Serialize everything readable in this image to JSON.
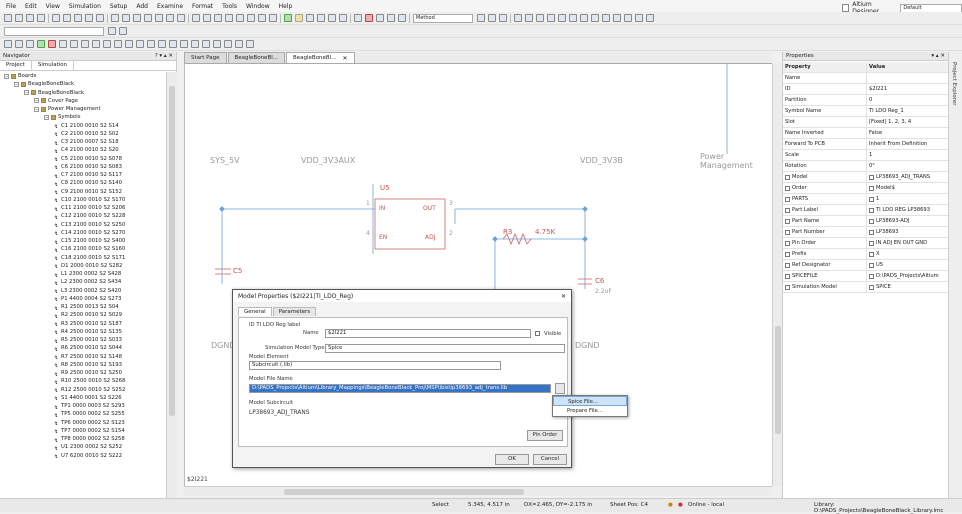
{
  "menu": {
    "items": [
      "File",
      "Edit",
      "View",
      "Simulation",
      "Setup",
      "Add",
      "Examine",
      "Format",
      "Tools",
      "Window",
      "Help"
    ],
    "license_label": "Altium Designer",
    "license_value": "Default"
  },
  "toolbar": {
    "method_value": "Method",
    "search_value": ""
  },
  "navigator": {
    "title": "Navigator",
    "controls": "? ▾ ▴ ✕",
    "tabs": [
      "Project",
      "Simulation"
    ],
    "tree": [
      {
        "label": "Boards",
        "level": 0
      },
      {
        "label": "BeagleBoneBlack",
        "level": 1
      },
      {
        "label": "BeagleBoneBlack",
        "level": 2
      },
      {
        "label": "Cover Page",
        "level": 3
      },
      {
        "label": "Power Management",
        "level": 3
      },
      {
        "label": "Symbols",
        "level": 4
      },
      {
        "label": "C1 2100 0010 S2 S14",
        "level": 5
      },
      {
        "label": "C2 2100 0010 S2 S02",
        "level": 5
      },
      {
        "label": "C3 2100 0007 S2 S18",
        "level": 5
      },
      {
        "label": "C4 2100 0010 S2 S20",
        "level": 5
      },
      {
        "label": "C5 2100 0010 S2 S078",
        "level": 5
      },
      {
        "label": "C6 2100 0010 S2 S083",
        "level": 5
      },
      {
        "label": "C7 2100 0010 S2 S117",
        "level": 5
      },
      {
        "label": "C8 2100 0010 S2 S140",
        "level": 5
      },
      {
        "label": "C9 2100 0010 S2 S152",
        "level": 5
      },
      {
        "label": "C10 2100 0010 S2 S170",
        "level": 5
      },
      {
        "label": "C11 2100 0010 S2 S206",
        "level": 5
      },
      {
        "label": "C12 2100 0010 S2 S228",
        "level": 5
      },
      {
        "label": "C13 2100 0010 S2 S250",
        "level": 5
      },
      {
        "label": "C14 2100 0010 S2 S270",
        "level": 5
      },
      {
        "label": "C15 2100 0010 S2 S400",
        "level": 5
      },
      {
        "label": "C16 2100 0010 S2 S160",
        "level": 5
      },
      {
        "label": "C18 2100 0010 S2 S171",
        "level": 5
      },
      {
        "label": "D1 2000 0010 S2 S282",
        "level": 5
      },
      {
        "label": "L1 2300 0002 S2 S428",
        "level": 5
      },
      {
        "label": "L2 2300 0002 S2 S434",
        "level": 5
      },
      {
        "label": "L3 2300 0002 S2 S420",
        "level": 5
      },
      {
        "label": "P1 4400 0004 S2 S273",
        "level": 5
      },
      {
        "label": "R1 2500 0013 S2 S04",
        "level": 5
      },
      {
        "label": "R2 2500 0010 S2 S029",
        "level": 5
      },
      {
        "label": "R3 2500 0010 S2 S187",
        "level": 5
      },
      {
        "label": "R4 2500 0010 S2 S135",
        "level": 5
      },
      {
        "label": "R5 2500 0010 S2 S033",
        "level": 5
      },
      {
        "label": "R6 2500 0010 S2 S044",
        "level": 5
      },
      {
        "label": "R7 2500 0010 S2 S148",
        "level": 5
      },
      {
        "label": "R8 2500 0010 S2 S193",
        "level": 5
      },
      {
        "label": "R9 2500 0010 S2 S250",
        "level": 5
      },
      {
        "label": "R10 2500 0010 S2 S268",
        "level": 5
      },
      {
        "label": "R12 2500 0010 S2 S252",
        "level": 5
      },
      {
        "label": "S1 4400 0001 S2 S226",
        "level": 5
      },
      {
        "label": "TP1 0000 0003 S2 S293",
        "level": 5
      },
      {
        "label": "TP5 0000 0002 S2 S255",
        "level": 5
      },
      {
        "label": "TP6 0000 0002 S2 S123",
        "level": 5
      },
      {
        "label": "TP7 0000 0002 S2 S154",
        "level": 5
      },
      {
        "label": "TP8 0000 0002 S2 S258",
        "level": 5
      },
      {
        "label": "U1 2300 0002 S2 S252",
        "level": 5
      },
      {
        "label": "U7 6200 0010 S2 S222",
        "level": 5
      }
    ]
  },
  "doc_tabs": [
    "Start Page",
    "BeagleBoneBl...",
    "BeagleBoneBl..."
  ],
  "schematic": {
    "net_sys": "SYS_5V",
    "net_vdd_in": "VDD_3V3AUX",
    "net_vdd_out": "VDD_3V3B",
    "sheet_title": "Power Management",
    "u_ref": "U5",
    "pin_in": "IN",
    "pin_out": "OUT",
    "pin_en": "EN",
    "pin_adj": "ADJ",
    "pin_num_in": "1",
    "pin_num_out": "3",
    "pin_num_en": "4",
    "pin_num_adj": "2",
    "c_left": "C5",
    "c_right": "C6",
    "c_right_val": "2.2uF",
    "r_ref": "R3",
    "r_val": "4.75K",
    "dgnd_left": "DGND",
    "dgnd_right": "DGND",
    "footer_id": "$2I221"
  },
  "dialog": {
    "title": "Model Properties ($2I221|TI_LDO_Reg)",
    "tabs": [
      "General",
      "Parameters"
    ],
    "ld_label": "ID TI LDO Reg label",
    "name_label": "Name",
    "name_value": "$2I221",
    "visible_label": "Visible",
    "sim_type_label": "Simulation Model Type",
    "sim_type_value": "Spice",
    "model_element_label": "Model Element",
    "model_element_value": "Subcircuit (.lib)",
    "model_file_label": "Model File Name",
    "model_file_value": "D:\\PADS_Projects\\Altium\\Library_Mappings\\BeagleBoneBlack_Proj\\MSP\\ibis\\lp38693_adj_trans.lib",
    "model_subckt_label": "Model Subcircuit",
    "model_subckt_value": "LP38693_ADJ_TRANS",
    "pin_order_btn": "Pin Order",
    "ok_btn": "OK",
    "cancel_btn": "Cancel"
  },
  "context_menu": [
    "Spice File...",
    "Prepare File..."
  ],
  "properties": {
    "title": "Properties",
    "controls": "▾ ▴ ✕",
    "header": [
      "Property",
      "Value"
    ],
    "rows": [
      {
        "k": "Name",
        "v": "",
        "cb": false
      },
      {
        "k": "ID",
        "v": "$2I221",
        "cb": false
      },
      {
        "k": "Partition",
        "v": "0",
        "cb": false
      },
      {
        "k": "Symbol Name",
        "v": "TI LDO Reg_1",
        "cb": false
      },
      {
        "k": "Slot",
        "v": "[Fixed] 1, 2, 3, 4",
        "cb": false
      },
      {
        "k": "Name Inverted",
        "v": "False",
        "cb": false
      },
      {
        "k": "Forward To PCB",
        "v": "Inherit From Definition",
        "cb": false
      },
      {
        "k": "Scale",
        "v": "1",
        "cb": false
      },
      {
        "k": "Rotation",
        "v": "0°",
        "cb": false
      },
      {
        "k": "Model",
        "v": "LP38693_ADJ_TRANS",
        "cb": true
      },
      {
        "k": "Order",
        "v": "Model$",
        "cb": true
      },
      {
        "k": "PARTS",
        "v": "1",
        "cb": true
      },
      {
        "k": "Part Label",
        "v": "TI LDO REG LP38693",
        "cb": true
      },
      {
        "k": "Part Name",
        "v": "LP38693-ADJ",
        "cb": true
      },
      {
        "k": "Part Number",
        "v": "LP38693",
        "cb": true
      },
      {
        "k": "Pin Order",
        "v": "IN ADJ EN OUT GND",
        "cb": true
      },
      {
        "k": "Prefix",
        "v": "X",
        "cb": true
      },
      {
        "k": "Ref Designator",
        "v": "U5",
        "cb": true
      },
      {
        "k": "SPICEFILE",
        "v": "D:\\PADS_Projects\\Altium",
        "cb": true
      },
      {
        "k": "Simulation Model",
        "v": "SPICE",
        "cb": true
      }
    ]
  },
  "side_strip": "Project Explorer",
  "status": {
    "mode": "Select",
    "coords": "5.345, 4.517 in",
    "delta": "DX=2.465, DY=-2.175 in",
    "sheet": "Sheet Pos: C4",
    "online": "Online - local",
    "path": "Library: D:\\PADS_Projects\\BeagleBoneBlack_Library.lmc"
  }
}
